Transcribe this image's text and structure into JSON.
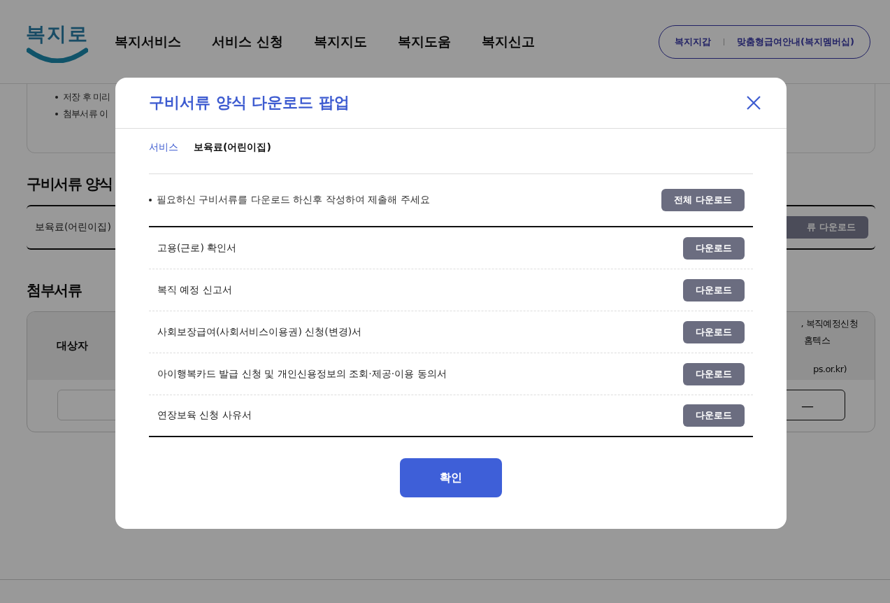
{
  "header": {
    "logo": "복지로",
    "nav": [
      "복지서비스",
      "서비스 신청",
      "복지지도",
      "복지도움",
      "복지신고"
    ],
    "links": [
      "복지지갑",
      "맞춤형급여안내(복지멤버십)"
    ]
  },
  "notice": {
    "bullets": [
      "저장 후 미리",
      "첨부서류 이"
    ]
  },
  "forms_section": {
    "title": "구비서류 양식",
    "service": "보육료(어린이집)",
    "button": "류 다운로드"
  },
  "attachments_section": {
    "title": "첨부서류",
    "column_1": "대상자",
    "column_2_lines": [
      ", 복직예정신청",
      "홈텍스",
      "ps.or.kr)"
    ],
    "button": "—"
  },
  "modal": {
    "title": "구비서류 양식 다운로드 팝업",
    "service_label": "서비스",
    "service_value": "보육료(어린이집)",
    "notice": "필요하신 구비서류를 다운로드 하신후 작성하여 제출해 주세요",
    "download_all": "전체 다운로드",
    "documents": [
      {
        "name": "고용(근로) 확인서",
        "button": "다운로드"
      },
      {
        "name": "복직 예정 신고서",
        "button": "다운로드"
      },
      {
        "name": "사회보장급여(사회서비스이용권) 신청(변경)서",
        "button": "다운로드"
      },
      {
        "name": "아이행복카드 발급 신청 및 개인신용정보의 조회·제공·이용 동의서",
        "button": "다운로드"
      },
      {
        "name": "연장보육 신청 사유서",
        "button": "다운로드"
      }
    ],
    "confirm": "확인"
  }
}
